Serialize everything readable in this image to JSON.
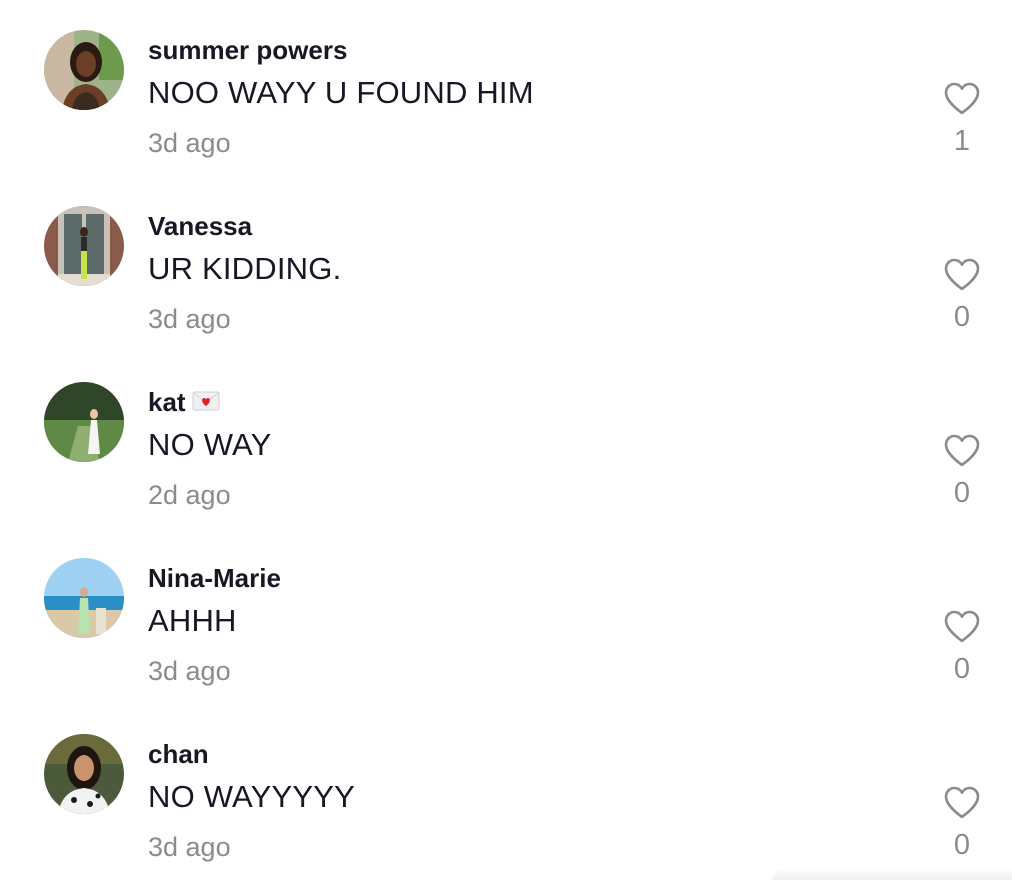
{
  "comments": [
    {
      "username": "summer powers",
      "text": "NOO WAYY U FOUND HIM",
      "time": "3d ago",
      "likes": "1",
      "avatar_icon": "avatar-photo"
    },
    {
      "username": "Vanessa",
      "text": "UR KIDDING.",
      "time": "3d ago",
      "likes": "0",
      "avatar_icon": "avatar-photo"
    },
    {
      "username": "kat",
      "username_badge_icon": "love-letter-emoji",
      "text": "NO WAY",
      "time": "2d ago",
      "likes": "0",
      "avatar_icon": "avatar-photo"
    },
    {
      "username": "Nina-Marie",
      "text": "AHHH",
      "time": "3d ago",
      "likes": "0",
      "avatar_icon": "avatar-photo"
    },
    {
      "username": "chan",
      "text": "NO WAYYYYY",
      "time": "3d ago",
      "likes": "0",
      "avatar_icon": "avatar-photo"
    }
  ],
  "like_icon": "heart-outline-icon",
  "colors": {
    "text_primary": "#161823",
    "text_secondary": "#8a8b91",
    "background": "#ffffff"
  }
}
